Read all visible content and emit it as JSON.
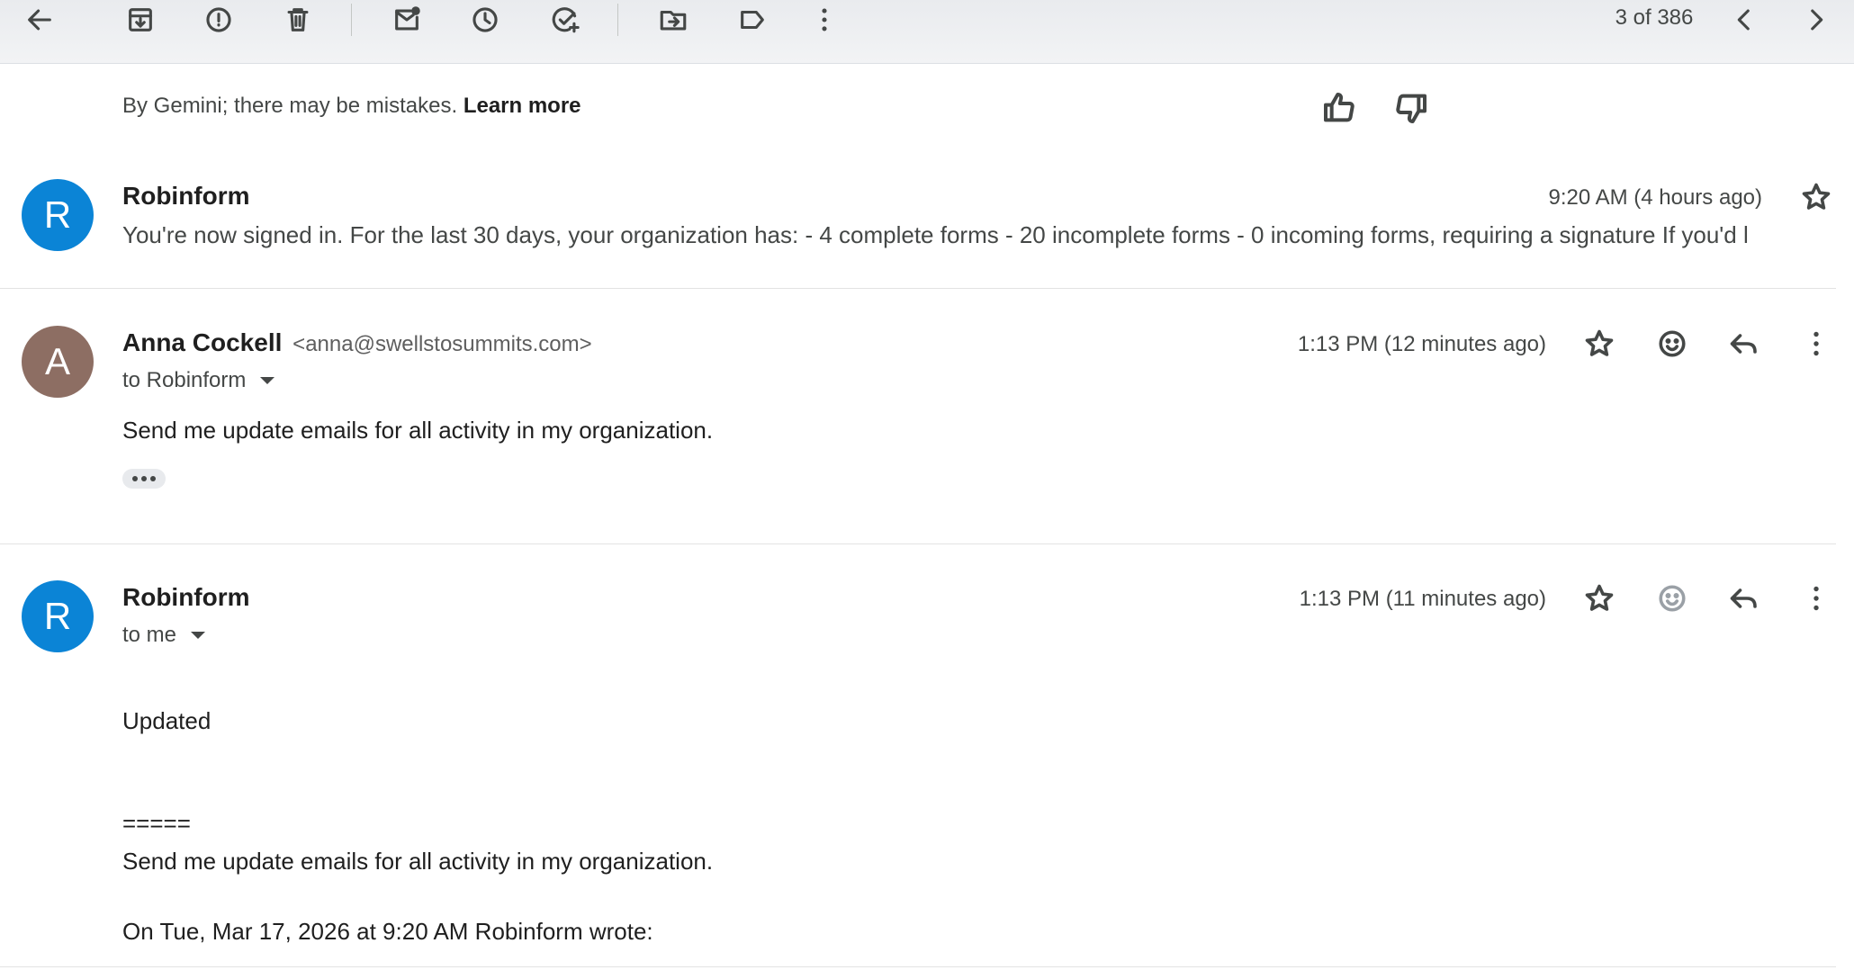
{
  "toolbar": {
    "icons": [
      "back-arrow-icon",
      "archive-icon",
      "report-spam-icon",
      "delete-icon",
      "mark-unread-icon",
      "snooze-icon",
      "add-task-icon",
      "move-to-icon",
      "label-icon",
      "more-vert-icon"
    ],
    "pager": "3 of 386"
  },
  "gemini": {
    "note": "By Gemini; there may be mistakes.",
    "learn_more": "Learn more"
  },
  "messages": [
    {
      "avatar_letter": "R",
      "avatar_color": "#0b84d6",
      "sender": "Robinform",
      "time": "9:20 AM (4 hours ago)",
      "snippet": "You're now signed in. For the last 30 days, your organization has: - 4 complete forms - 20 incomplete forms - 0 incoming forms, requiring a signature If you'd l"
    },
    {
      "avatar_letter": "A",
      "avatar_color": "#8d6e63",
      "sender": "Anna Cockell",
      "email": "<anna@swellstosummits.com>",
      "to": "to Robinform",
      "time": "1:13 PM (12 minutes ago)",
      "body": "Send me update emails for all activity in my organization."
    },
    {
      "avatar_letter": "R",
      "avatar_color": "#0b84d6",
      "sender": "Robinform",
      "to": "to me",
      "time": "1:13 PM (11 minutes ago)",
      "body_lines": [
        "Updated",
        "=====",
        "Send me update emails for all activity in my organization.",
        "On Tue, Mar 17, 2026 at 9:20 AM Robinform wrote:"
      ]
    }
  ]
}
